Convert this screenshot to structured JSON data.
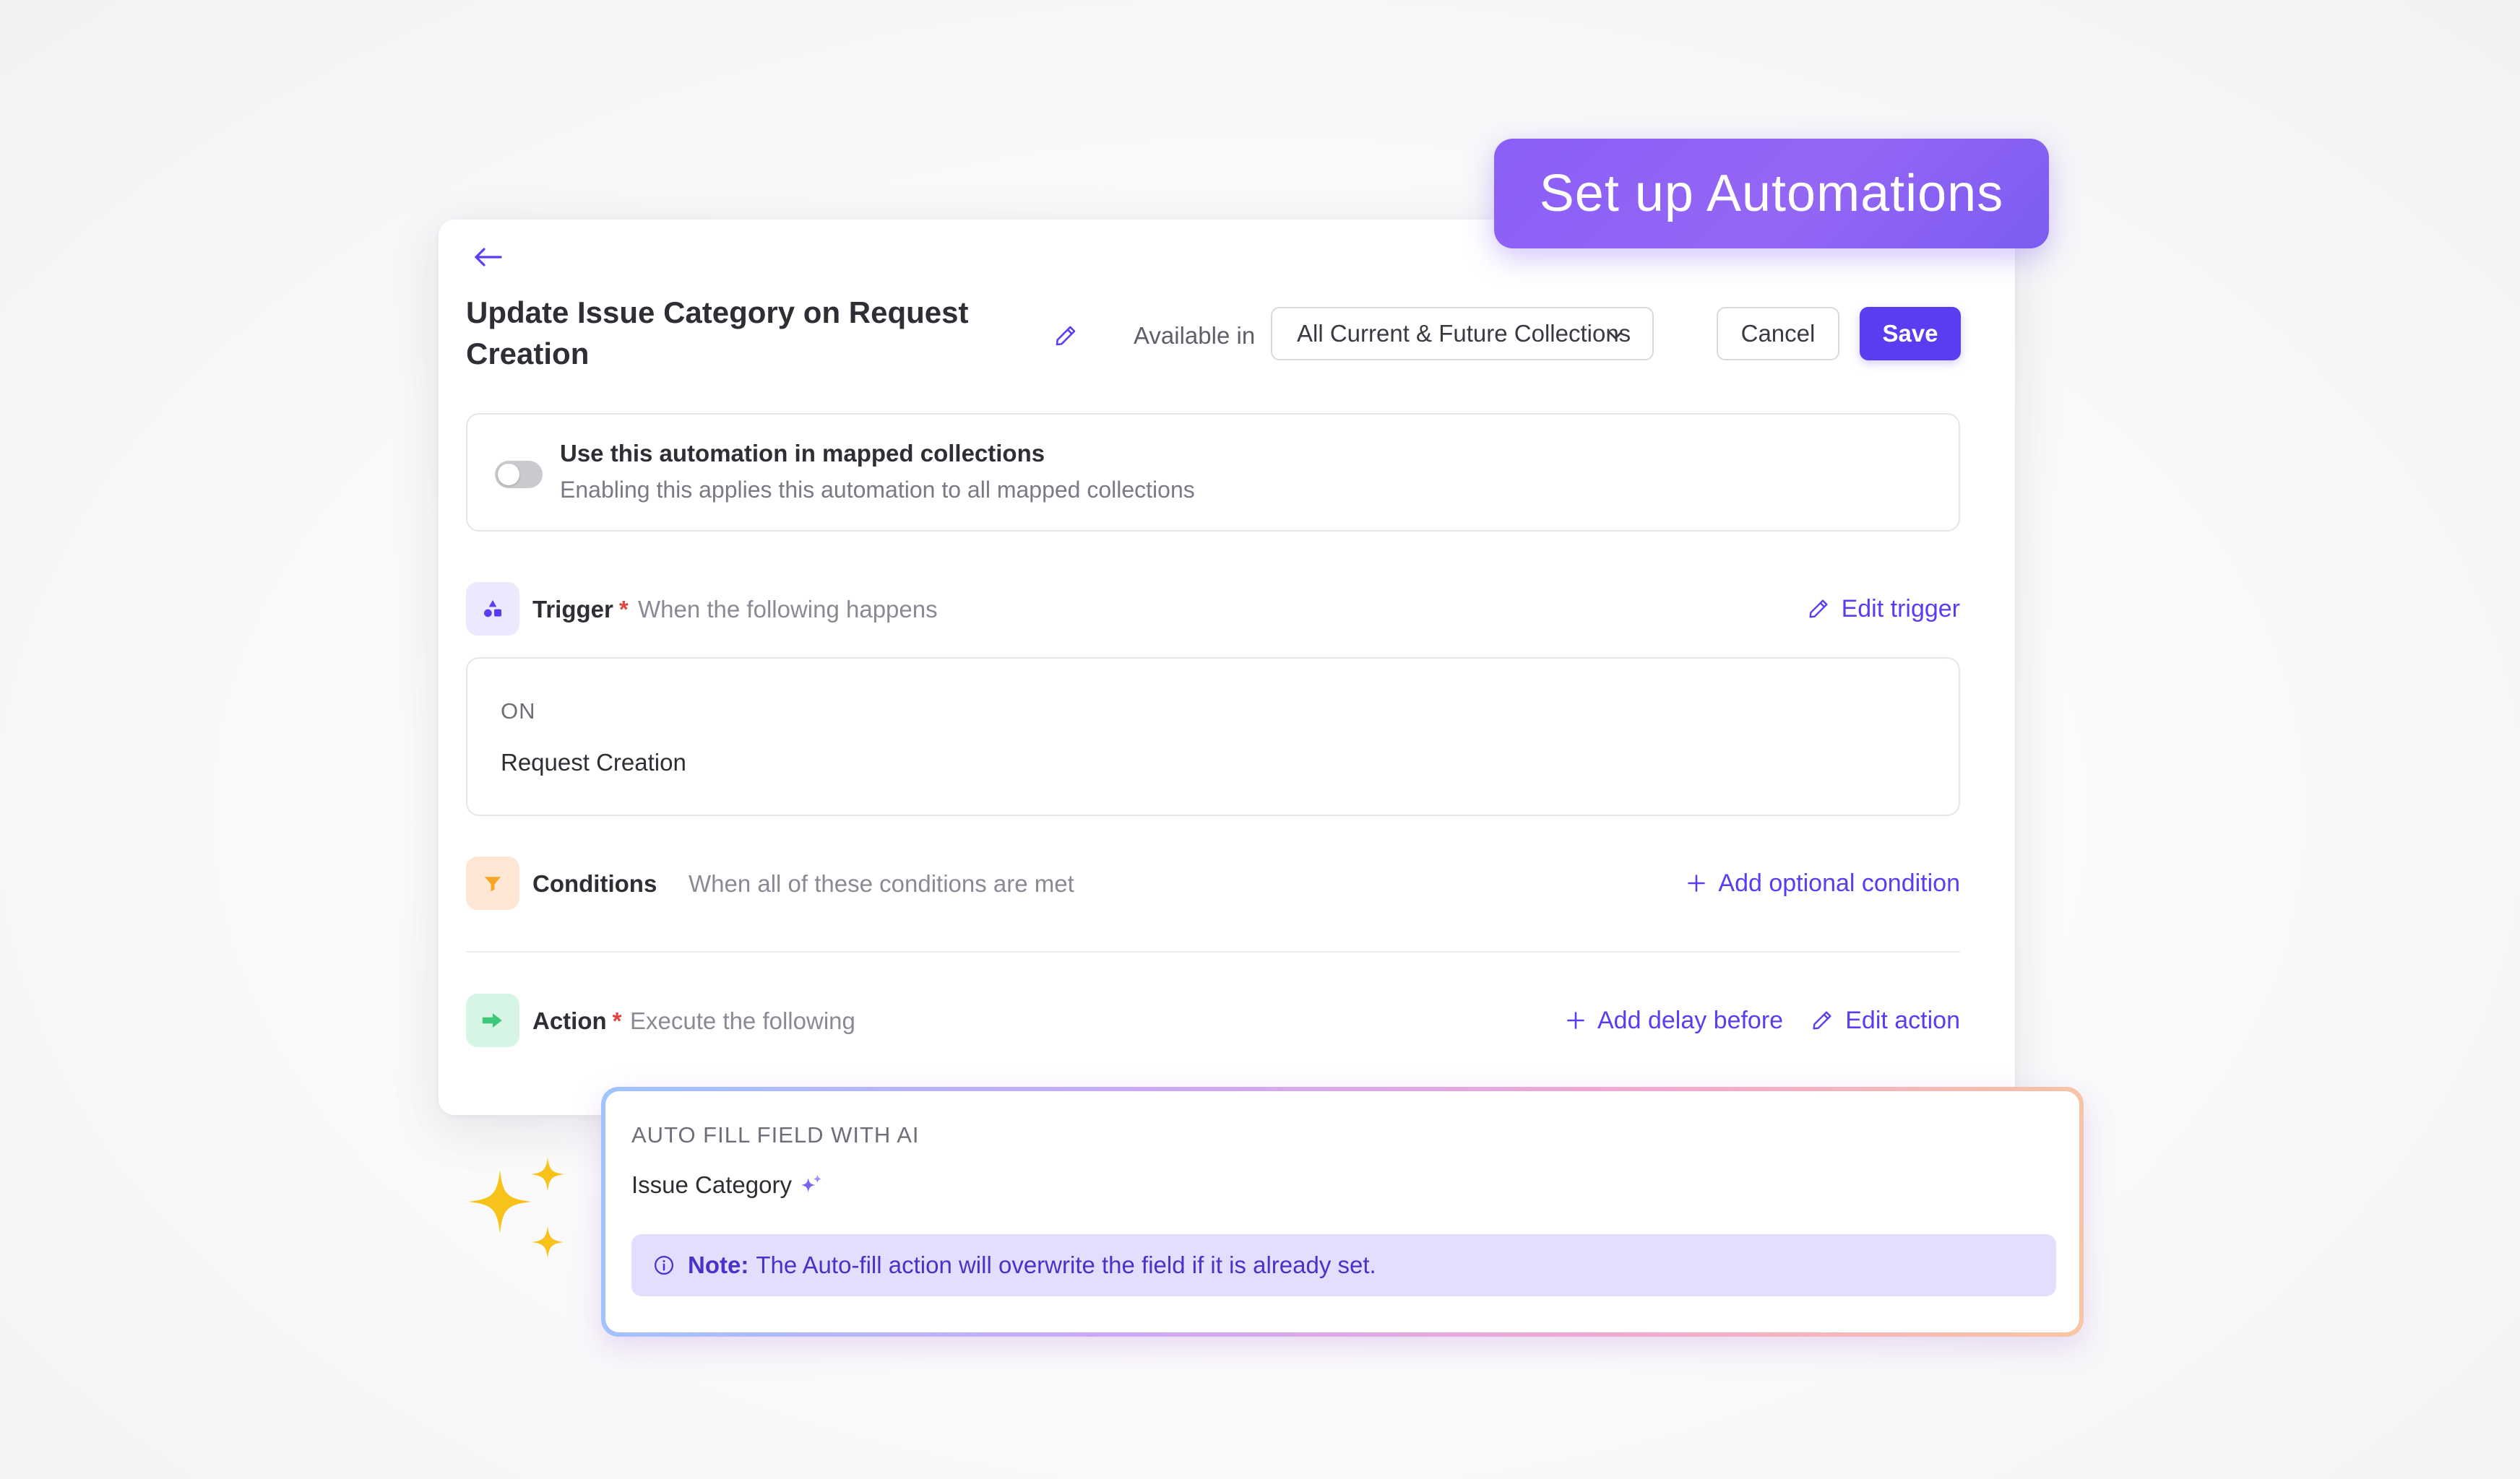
{
  "pill": {
    "label": "Set up Automations"
  },
  "header": {
    "title": "Update Issue Category on Request Creation",
    "available_label": "Available in",
    "collection_value": "All Current & Future Collections",
    "cancel_label": "Cancel",
    "save_label": "Save"
  },
  "mapped": {
    "title": "Use this automation in mapped collections",
    "description": "Enabling this applies this automation to all mapped collections",
    "toggle_on": false
  },
  "trigger": {
    "label": "Trigger",
    "required_mark": "*",
    "description": "When the following happens",
    "link_label": "Edit trigger",
    "on_label": "ON",
    "value": "Request Creation"
  },
  "conditions": {
    "label": "Conditions",
    "description": "When all of these conditions are met",
    "link_label": "Add optional condition"
  },
  "action": {
    "label": "Action",
    "required_mark": "*",
    "description": "Execute the following",
    "delay_label": "Add delay before",
    "link_label": "Edit action",
    "card_title": "AUTO FILL FIELD WITH AI",
    "field_name": "Issue Category",
    "note_strong": "Note:",
    "note_text": "The Auto-fill action will overwrite the field if it is already set."
  },
  "colors": {
    "accent": "#5a3df0",
    "pill_gradient_start": "#8a5ff7",
    "note_bg": "#e4ddfd",
    "required": "#e0453d",
    "trigger_icon_bg": "#ece8fd",
    "conditions_icon_bg": "#fde6d3",
    "action_icon_bg": "#d7f5e5",
    "sparkle": "#f7c21a"
  },
  "icons": {
    "back": "arrow-left-icon",
    "edit": "pencil-icon",
    "dropdown": "chevron-down-icon",
    "trigger": "shapes-icon",
    "conditions": "funnel-icon",
    "action": "arrow-right-icon",
    "add": "plus-icon",
    "ai": "sparkle-icon",
    "info": "info-icon"
  }
}
